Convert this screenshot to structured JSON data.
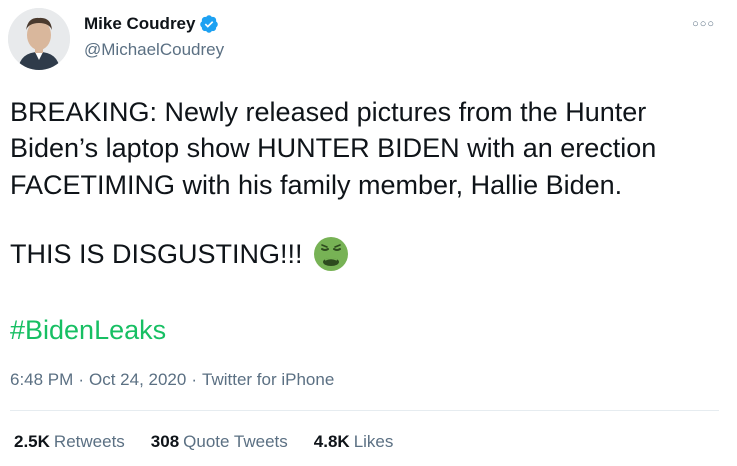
{
  "author": {
    "display_name": "Mike Coudrey",
    "handle": "@MichaelCoudrey",
    "verified_icon": "verified-badge-icon",
    "avatar_icon": "profile-photo"
  },
  "more_icon": "more-options-icon",
  "tweet": {
    "lines": [
      "BREAKING: Newly released pictures from the Hunter",
      "Biden’s laptop show HUNTER BIDEN with an erection",
      "FACETIMING with his family member, Hallie Biden."
    ],
    "emphasis_text": "THIS IS DISGUSTING!!!",
    "emoji_icon": "nauseated-face-icon",
    "hashtag": "#BidenLeaks"
  },
  "meta": {
    "time": "6:48 PM",
    "date": "Oct 24, 2020",
    "source": "Twitter for iPhone",
    "separator": "·"
  },
  "stats": {
    "retweets_count": "2.5K",
    "retweets_label": "Retweets",
    "quotes_count": "308",
    "quotes_label": "Quote Tweets",
    "likes_count": "4.8K",
    "likes_label": "Likes"
  },
  "colors": {
    "text": "#0f1419",
    "secondary": "#5b7083",
    "hashtag": "#17bf63",
    "verified": "#1da1f2",
    "divider": "#e6ecf0"
  }
}
